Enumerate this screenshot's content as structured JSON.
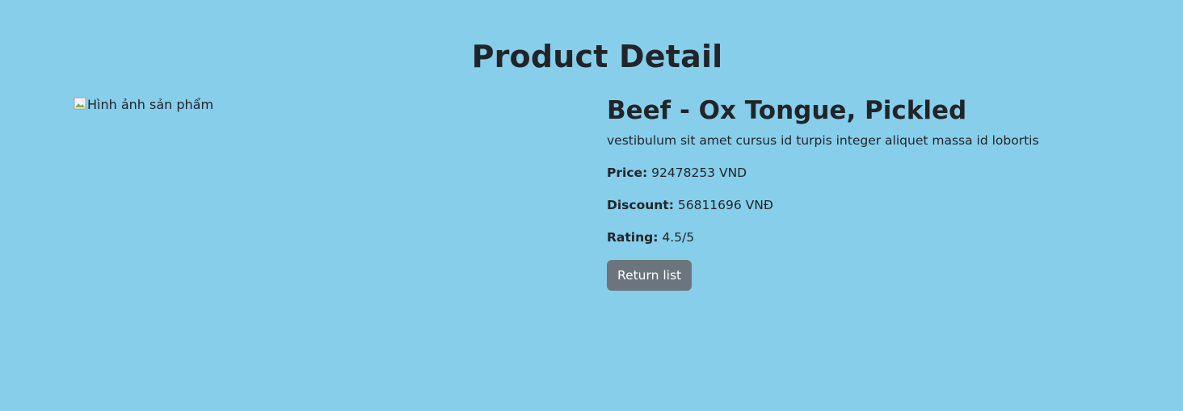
{
  "page": {
    "title": "Product Detail",
    "background_color": "#87ceeb"
  },
  "product": {
    "image_alt": "Hình ảnh sản phẩm",
    "name": "Beef - Ox Tongue, Pickled",
    "description": "vestibulum sit amet cursus id turpis integer aliquet massa id lobortis",
    "price_label": "Price:",
    "price_value": "92478253 VND",
    "discount_label": "Discount:",
    "discount_value": "56811696 VNĐ",
    "rating_label": "Rating:",
    "rating_value": "4.5/5"
  },
  "actions": {
    "return_label": "Return list",
    "return_button_color": "#6c757d"
  }
}
